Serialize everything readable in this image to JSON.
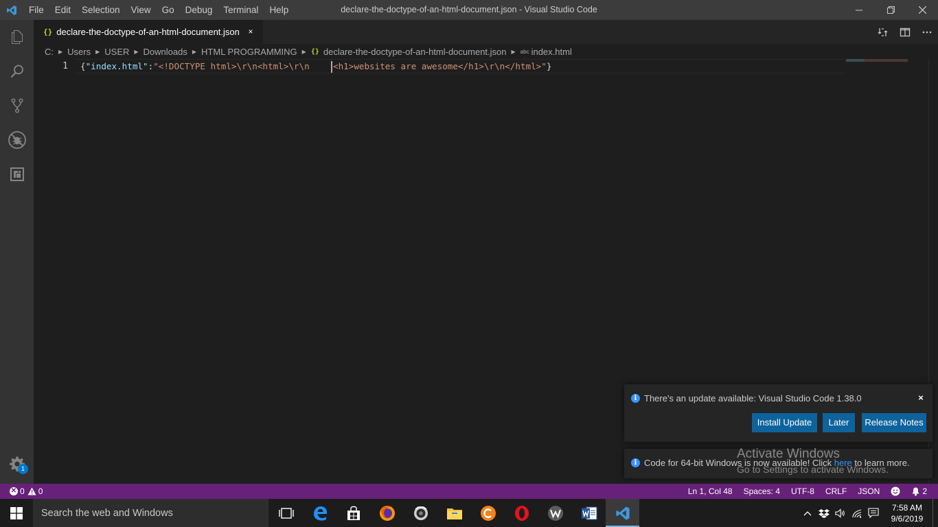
{
  "window": {
    "title": "declare-the-doctype-of-an-html-document.json - Visual Studio Code",
    "menu": [
      "File",
      "Edit",
      "Selection",
      "View",
      "Go",
      "Debug",
      "Terminal",
      "Help"
    ]
  },
  "activitybar": {
    "items": [
      "explorer-icon",
      "search-icon",
      "source-control-icon",
      "debug-icon",
      "extensions-icon"
    ],
    "settings_badge": "1"
  },
  "tab": {
    "icon": "{}",
    "label": "declare-the-doctype-of-an-html-document.json",
    "close": "×"
  },
  "breadcrumbs": {
    "drive": "C:",
    "users": "Users",
    "user": "USER",
    "downloads": "Downloads",
    "folder": "HTML PROGRAMMING",
    "file_icon": "{}",
    "file": "declare-the-doctype-of-an-html-document.json",
    "symbol_icon": "abc",
    "symbol": "index.html"
  },
  "editor": {
    "line_number": "1",
    "tokens": {
      "open": "{",
      "key": "\"index.html\"",
      "colon": ":",
      "str_before_cursor": "\"<!DOCTYPE html>\\r\\n<html>\\r\\n    ",
      "str_after_cursor": "<h1>websites are awesome</h1>\\r\\n</html>\"",
      "close": "}"
    }
  },
  "notifications": {
    "update": {
      "message": "There's an update available: Visual Studio Code 1.38.0",
      "install_button": "Install Update",
      "later_button": "Later",
      "release_notes_button": "Release Notes",
      "close": "×"
    },
    "x64": {
      "message_before": "Code for 64-bit Windows is now available! Click ",
      "link": "here",
      "message_after": " to learn more."
    }
  },
  "watermark": {
    "line1": "Activate Windows",
    "line2": "Go to Settings to activate Windows."
  },
  "statusbar": {
    "errors": "0",
    "warnings": "0",
    "position": "Ln 1, Col 48",
    "spaces": "Spaces: 4",
    "encoding": "UTF-8",
    "eol": "CRLF",
    "language": "JSON",
    "notifications_count": "2",
    "color": "#68217a"
  },
  "taskbar": {
    "search_placeholder": "Search the web and Windows",
    "apps": [
      "task-view-icon",
      "edge-icon",
      "store-icon",
      "firefox-icon",
      "camera-app-icon",
      "file-explorer-icon",
      "ccleaner-icon",
      "opera-icon",
      "wps-icon",
      "word-icon",
      "vscode-icon"
    ],
    "time": "7:58 AM",
    "date": "9/6/2019"
  }
}
